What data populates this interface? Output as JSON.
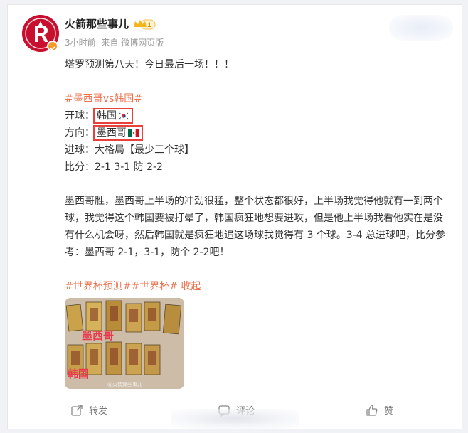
{
  "post": {
    "author": {
      "name": "火箭那些事儿",
      "vip_level": "1"
    },
    "meta": {
      "time": "3小时前",
      "source": "来自 微博网页版"
    },
    "content": {
      "line1": "塔罗预测第八天！今日最后一场！！！",
      "match_tag": "#墨西哥vs韩国#",
      "kickoff_label": "开球：",
      "kickoff_value": "韩国",
      "direction_label": "方向：",
      "direction_value": "墨西哥",
      "goals": "进球：大格局【最少三个球】",
      "score": "比分：2-1 3-1 防 2-2",
      "paragraph": "墨西哥胜，墨西哥上半场的冲劲很猛，整个状态都很好，上半场我觉得他就有一到两个球，我觉得这个韩国要被打晕了，韩国疯狂地想要进攻，但是他上半场我看他实在是没有什么机会呀，然后韩国就是疯狂地追这场球我觉得有 3 个球。3-4 总进球吧，比分参考：墨西哥 2-1，3-1，防个 2-2吧！",
      "tags": [
        "#世界杯预测#",
        "#世界杯#"
      ],
      "collapse": "收起"
    },
    "image": {
      "label_top": "墨西哥",
      "label_bottom": "韩国",
      "watermark": "@火箭那些事儿"
    },
    "actions": {
      "forward": "转发",
      "comment": "评论",
      "like": "赞"
    }
  },
  "colors": {
    "hashtag": "#eb7350",
    "highlight_box": "#e8413b",
    "brand": "#c8102e",
    "verified": "#f39a2b"
  },
  "icons": [
    "rockets-logo-icon",
    "verified-icon",
    "vip-crown-icon",
    "korea-flag-icon",
    "mexico-flag-icon",
    "forward-icon",
    "comment-icon",
    "like-icon"
  ]
}
